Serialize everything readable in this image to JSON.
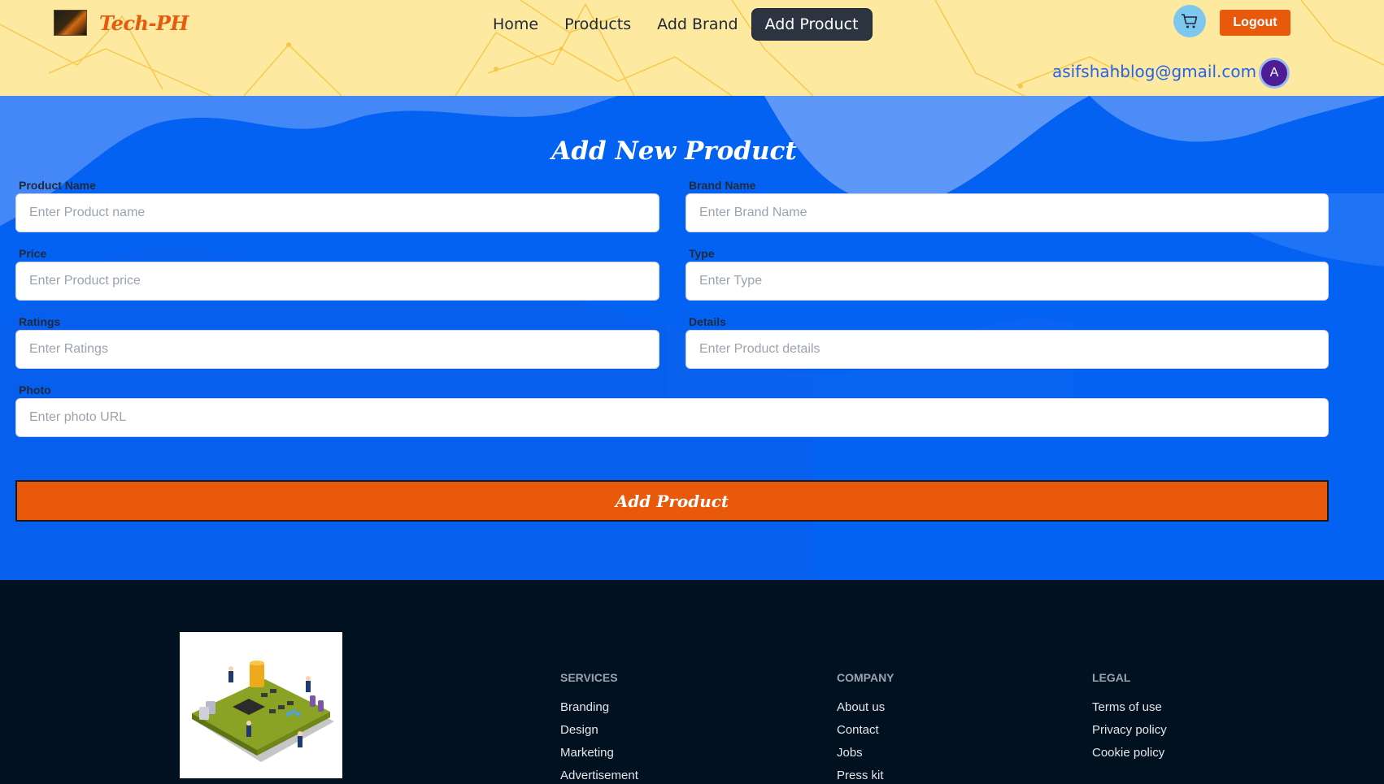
{
  "navbar": {
    "brand_name": "Tech-PH",
    "menu": [
      "Home",
      "Products",
      "Add Brand",
      "Add Product"
    ],
    "active_item": "Add Product",
    "logout_label": "Logout",
    "user_email": "asifshahblog@gmail.com",
    "avatar_initial": "A",
    "colors": {
      "background": "#fde9a0",
      "accent": "#e8590c",
      "active_menu": "#2b3440"
    }
  },
  "form": {
    "title": "Add New Product",
    "fields": {
      "product_name": {
        "label": "Product Name",
        "placeholder": "Enter Product name"
      },
      "brand_name": {
        "label": "Brand Name",
        "placeholder": "Enter Brand Name"
      },
      "price": {
        "label": "Price",
        "placeholder": "Enter Product price"
      },
      "type": {
        "label": "Type",
        "placeholder": "Enter Type"
      },
      "ratings": {
        "label": "Ratings",
        "placeholder": "Enter Ratings"
      },
      "details": {
        "label": "Details",
        "placeholder": "Enter Product details"
      },
      "photo": {
        "label": "Photo",
        "placeholder": "Enter photo URL"
      }
    },
    "submit_label": "Add Product",
    "colors": {
      "background": "#0462f3",
      "button": "#e8590c"
    }
  },
  "footer": {
    "services": {
      "heading": "SERVICES",
      "links": [
        "Branding",
        "Design",
        "Marketing",
        "Advertisement"
      ]
    },
    "company": {
      "heading": "COMPANY",
      "links": [
        "About us",
        "Contact",
        "Jobs",
        "Press kit"
      ]
    },
    "legal": {
      "heading": "LEGAL",
      "links": [
        "Terms of use",
        "Privacy policy",
        "Cookie policy"
      ]
    },
    "colors": {
      "background": "#02111f"
    }
  },
  "icons": [
    "cart-icon",
    "brand-logo-icon",
    "circuit-board-illustration"
  ]
}
